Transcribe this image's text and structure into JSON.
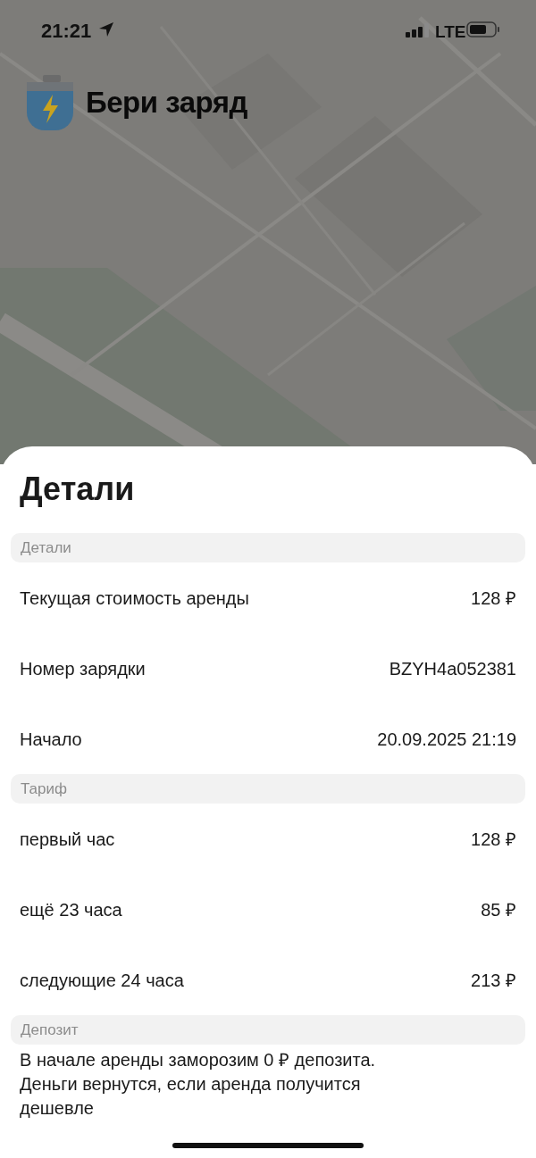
{
  "status_bar": {
    "time": "21:21",
    "network": "LTE"
  },
  "app": {
    "title": "Бери заряд"
  },
  "sheet": {
    "title": "Детали",
    "sections": [
      {
        "kind": "rows",
        "header": "Детали",
        "rows": [
          {
            "label": "Текущая стоимость аренды",
            "value": "128 ₽"
          },
          {
            "label": "Номер зарядки",
            "value": "BZYH4a052381"
          },
          {
            "label": "Начало",
            "value": "20.09.2025 21:19"
          }
        ]
      },
      {
        "kind": "rows",
        "header": "Тариф",
        "rows": [
          {
            "label": "первый час",
            "value": "128 ₽"
          },
          {
            "label": "ещё 23 часа",
            "value": "85 ₽"
          },
          {
            "label": "следующие 24 часа",
            "value": "213 ₽"
          }
        ]
      },
      {
        "kind": "text",
        "header": "Депозит",
        "text": "В начале аренды заморозим 0 ₽ депозита.\nДеньги вернутся, если аренда получится дешевле"
      }
    ]
  }
}
